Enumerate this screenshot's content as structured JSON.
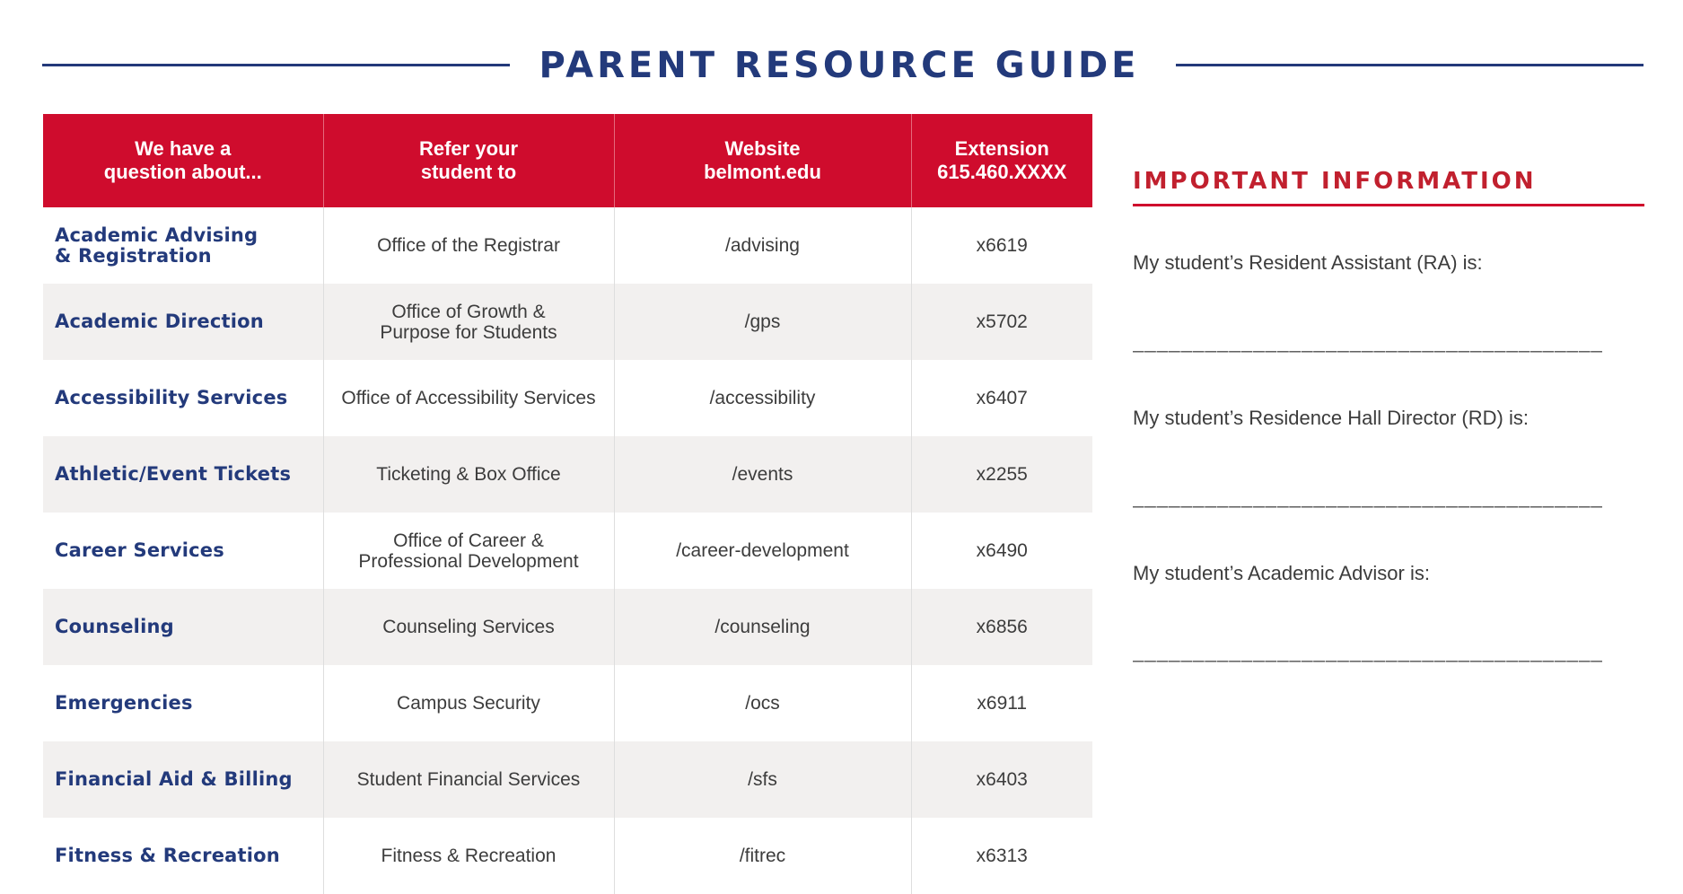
{
  "page": {
    "title": "PARENT RESOURCE GUIDE"
  },
  "table": {
    "headers": [
      [
        "We have a",
        "question about..."
      ],
      [
        "Refer your",
        "student to"
      ],
      [
        "Website",
        "belmont.edu"
      ],
      [
        "Extension",
        "615.460.XXXX"
      ]
    ],
    "rows": [
      {
        "topic": [
          "Academic Advising",
          "& Registration"
        ],
        "refer": [
          "Office of the Registrar"
        ],
        "website": "/advising",
        "extension": "x6619"
      },
      {
        "topic": [
          "Academic Direction"
        ],
        "refer": [
          "Office of Growth &",
          "Purpose for Students"
        ],
        "website": "/gps",
        "extension": "x5702"
      },
      {
        "topic": [
          "Accessibility Services"
        ],
        "refer": [
          "Office of Accessibility Services"
        ],
        "website": "/accessibility",
        "extension": "x6407"
      },
      {
        "topic": [
          "Athletic/Event Tickets"
        ],
        "refer": [
          "Ticketing & Box Office"
        ],
        "website": "/events",
        "extension": "x2255"
      },
      {
        "topic": [
          "Career Services"
        ],
        "refer": [
          "Office of Career &",
          "Professional Development"
        ],
        "website": "/career-development",
        "extension": "x6490"
      },
      {
        "topic": [
          "Counseling"
        ],
        "refer": [
          "Counseling Services"
        ],
        "website": "/counseling",
        "extension": "x6856"
      },
      {
        "topic": [
          "Emergencies"
        ],
        "refer": [
          "Campus Security"
        ],
        "website": "/ocs",
        "extension": "x6911"
      },
      {
        "topic": [
          "Financial Aid & Billing"
        ],
        "refer": [
          "Student Financial Services"
        ],
        "website": "/sfs",
        "extension": "x6403"
      },
      {
        "topic": [
          "Fitness & Recreation"
        ],
        "refer": [
          "Fitness & Recreation"
        ],
        "website": "/fitrec",
        "extension": "x6313"
      }
    ]
  },
  "info": {
    "heading": "IMPORTANT INFORMATION",
    "fields": [
      {
        "label": "My student’s Resident Assistant (RA) is:",
        "blank": "_______________________________________"
      },
      {
        "label": "My student’s Residence Hall Director (RD) is:",
        "blank": "_______________________________________"
      },
      {
        "label": "My student’s Academic Advisor is:",
        "blank": "_______________________________________"
      }
    ]
  },
  "colors": {
    "navy": "#233a7b",
    "red": "#cf0c2d",
    "heading_red": "#c1202e",
    "row_alt": "#f2f0ef",
    "body_text": "#3c3c3c"
  }
}
